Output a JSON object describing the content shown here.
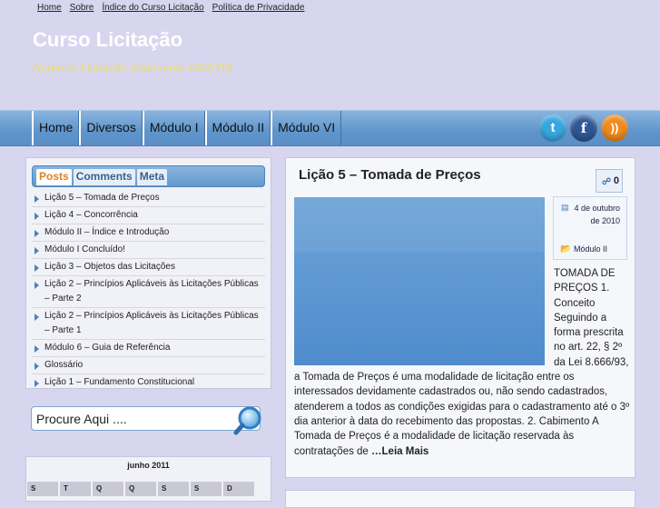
{
  "top_links": [
    "Home",
    "Sobre",
    "Índice do Curso Licitação",
    "Política de Privacidade"
  ],
  "site": {
    "title": "Curso Licitação",
    "tagline": "Aprenda Licitação totalmente GRÁTIS"
  },
  "nav": [
    "Home",
    "Diversos",
    "Módulo I",
    "Módulo II",
    "Módulo VI"
  ],
  "social": {
    "twitter_glyph": "t",
    "facebook_glyph": "f",
    "rss_glyph": "))"
  },
  "sidebar": {
    "tabs": [
      "Posts",
      "Comments",
      "Meta"
    ],
    "posts": [
      "Lição 5 – Tomada de Preços",
      "Lição 4 – Concorrência",
      "Módulo II – Índice e Introdução",
      "Módulo I Concluído!",
      "Lição 3 – Objetos das Licitações",
      "Lição 2 – Princípios Aplicáveis às Licitações Públicas – Parte 2",
      "Lição 2 – Princípios Aplicáveis às Licitações Públicas – Parte 1",
      "Módulo 6 – Guia de Referência",
      "Glossário",
      "Lição 1 – Fundamento Constitucional"
    ],
    "search_placeholder": "Procure Aqui ....",
    "calendar": {
      "caption": "junho 2011",
      "days": [
        "S",
        "T",
        "Q",
        "Q",
        "S",
        "S",
        "D"
      ]
    }
  },
  "post": {
    "title": "Lição 5 – Tomada de Preços",
    "comment_count": "0",
    "date": "4 de outubro de 2010",
    "category": "Módulo II",
    "body": "TOMADA DE PREÇOS 1. Conceito Seguindo a forma prescrita no art. 22, § 2º da Lei 8.666/93, a Tomada de Preços é uma modalidade de licitação entre os interessados devidamente cadastrados ou, não sendo cadastrados, atenderem a todos as condições exigidas para o cadastramento até o 3º dia anterior à data do recebimento das propostas. 2. Cabimento A Tomada de Preços é a modalidade de licitação reservada às contratações de ",
    "read_more": "…Leia Mais"
  },
  "colors": {
    "background": "#d8d6ef",
    "nav": "#5f95cc",
    "tagline": "#e9dd6e",
    "active_tab": "#e2801e"
  }
}
